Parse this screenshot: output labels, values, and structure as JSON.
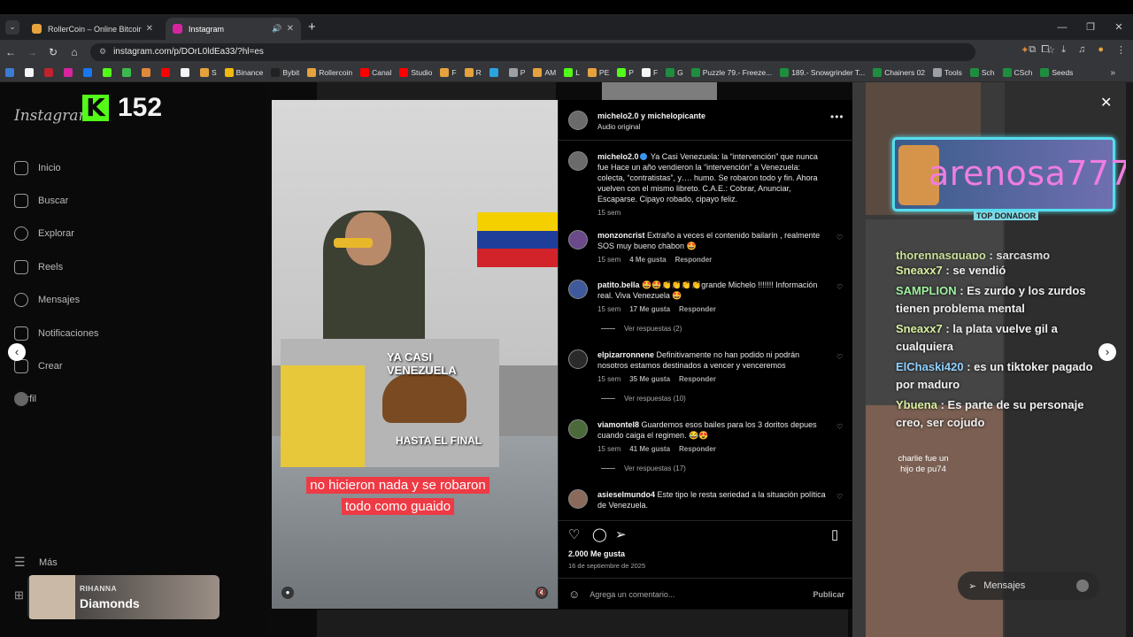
{
  "browser": {
    "tabs": [
      {
        "title": "RollerCoin – Online Bitcoin Mi…",
        "icon": "rollercoin-icon",
        "color": "#e6a23c"
      },
      {
        "title": "Instagram",
        "icon": "instagram-icon",
        "color": "#d6249f"
      }
    ],
    "url": "instagram.com/p/DOrL0ldEa33/?hl=es",
    "bookmarks": [
      {
        "label": "",
        "color": "#3b7bd6"
      },
      {
        "label": "",
        "color": "#f5f5f5"
      },
      {
        "label": "",
        "color": "#c0232c"
      },
      {
        "label": "",
        "color": "#d6249f"
      },
      {
        "label": "",
        "color": "#1877f2"
      },
      {
        "label": "",
        "color": "#53fc18"
      },
      {
        "label": "",
        "color": "#3dba4e"
      },
      {
        "label": "",
        "color": "#e0893a"
      },
      {
        "label": "",
        "color": "#ff0000"
      },
      {
        "label": "",
        "color": "#f5f5f5"
      },
      {
        "label": "S",
        "color": "#e6a23c"
      },
      {
        "label": "Binance",
        "color": "#f0b90b"
      },
      {
        "label": "Bybit",
        "color": "#222222"
      },
      {
        "label": "Rollercoin",
        "color": "#e6a23c"
      },
      {
        "label": "Canal",
        "color": "#ff0000"
      },
      {
        "label": "Studio",
        "color": "#ff0000"
      },
      {
        "label": "F",
        "color": "#e6a23c"
      },
      {
        "label": "R",
        "color": "#e6a23c"
      },
      {
        "label": "",
        "color": "#2aa3e0"
      },
      {
        "label": "P",
        "color": "#9aa0a6"
      },
      {
        "label": "AM",
        "color": "#e6a23c"
      },
      {
        "label": "L",
        "color": "#53fc18"
      },
      {
        "label": "PE",
        "color": "#e6a23c"
      },
      {
        "label": "P",
        "color": "#53fc18"
      },
      {
        "label": "F",
        "color": "#f5f5f5"
      },
      {
        "label": "G",
        "color": "#1e8e3e"
      },
      {
        "label": "Puzzle 79.- Freeze...",
        "color": "#1e8e3e"
      },
      {
        "label": "189.- Snowgrinder T...",
        "color": "#1e8e3e"
      },
      {
        "label": "Chainers 02",
        "color": "#1e8e3e"
      },
      {
        "label": "Tools",
        "color": "#9aa0a6"
      },
      {
        "label": "Sch",
        "color": "#1e8e3e"
      },
      {
        "label": "CSch",
        "color": "#1e8e3e"
      },
      {
        "label": "Seeds",
        "color": "#1e8e3e"
      }
    ]
  },
  "sidebar": {
    "logo": "Instagram",
    "kick_count": "152",
    "items": [
      {
        "label": "Inicio",
        "icon": "home-icon"
      },
      {
        "label": "Buscar",
        "icon": "search-icon"
      },
      {
        "label": "Explorar",
        "icon": "compass-icon"
      },
      {
        "label": "Reels",
        "icon": "reels-icon"
      },
      {
        "label": "Mensajes",
        "icon": "messages-icon"
      },
      {
        "label": "Notificaciones",
        "icon": "heart-icon"
      },
      {
        "label": "Crear",
        "icon": "plus-icon"
      },
      {
        "label": "Perfil",
        "icon": "profile-avatar"
      }
    ],
    "more": "Más",
    "music": {
      "artist": "RIHANNA",
      "song": "Diamonds"
    }
  },
  "video": {
    "meme_top": "YA CASI VENEZUELA",
    "meme_bottom": "HASTA EL FINAL",
    "caption": "no hicieron nada y se robaron todo como guaido"
  },
  "post": {
    "header_user": "michelo2.0 y michelopicante",
    "header_audio": "Audio original",
    "caption_user": "michelo2.0",
    "caption_text": "Ya Casi Venezuela: la “intervención” que nunca fue Hace un año vendieron la “intervención” a Venezuela: colecta, “contratistas”, y…. humo. Se robaron todo y fin. Ahora vuelven con el mismo libreto. C.A.E.: Cobrar, Anunciar, Escaparse. Cipayo robado, cipayo feliz.",
    "caption_time": "15 sem",
    "reply_label": "Responder",
    "comments": [
      {
        "user": "monzoncrist",
        "text": "Extraño a veces el contenido bailarín , realmente SOS muy bueno chabon 🤩",
        "time": "15 sem",
        "likes": "4 Me gusta",
        "replies": ""
      },
      {
        "user": "patito.bella",
        "text": "🤩🤩👏👏👏👏grande Michelo !!!!!!! Información real. Viva Venezuela 🤩",
        "time": "15 sem",
        "likes": "17 Me gusta",
        "replies": "Ver respuestas (2)"
      },
      {
        "user": "elpizarronnene",
        "text": "Definitivamente no han podido ni podrán nosotros estamos destinados a vencer y venceremos",
        "time": "15 sem",
        "likes": "35 Me gusta",
        "replies": "Ver respuestas (10)"
      },
      {
        "user": "viamontel8",
        "text": "Guardemos esos bailes para los 3 doritos depues cuando caiga el regimen. 😂😍",
        "time": "15 sem",
        "likes": "41 Me gusta",
        "replies": "Ver respuestas (17)"
      },
      {
        "user": "asieselmundo4",
        "text": "Este tipo le resta seriedad a la situación política de Venezuela.",
        "time": "",
        "likes": "",
        "replies": ""
      }
    ],
    "likes_total": "2.000 Me gusta",
    "date": "16 de septiembre de 2025",
    "comment_placeholder": "Agrega un comentario...",
    "publish": "Publicar"
  },
  "overlay": {
    "donor_name": "arenosa777",
    "donor_tag": "TOP DONADOR",
    "chat": [
      {
        "user": "thorennasguapo",
        "text": ": sarcasmo",
        "color": "#d8f0a0"
      },
      {
        "user": "Sneaxx7",
        "text": ": se vendió",
        "color": "#d8f0a0"
      },
      {
        "user": "SAMPLION",
        "text": ": Es zurdo y los zurdos tienen problema mental",
        "color": "#a0f0a0"
      },
      {
        "user": "Sneaxx7",
        "text": ": la plata vuelve gil a cualquiera",
        "color": "#d8f0a0"
      },
      {
        "user": "ElChaski420",
        "text": ": es un tiktoker pagado por maduro",
        "color": "#8fd0ff"
      },
      {
        "user": "Ybuena",
        "text": ": Es parte de su personaje creo, ser cojudo",
        "color": "#d8f0a0"
      }
    ],
    "charlie": "charlie fue un hijo de pu74",
    "messages_label": "Mensajes"
  }
}
